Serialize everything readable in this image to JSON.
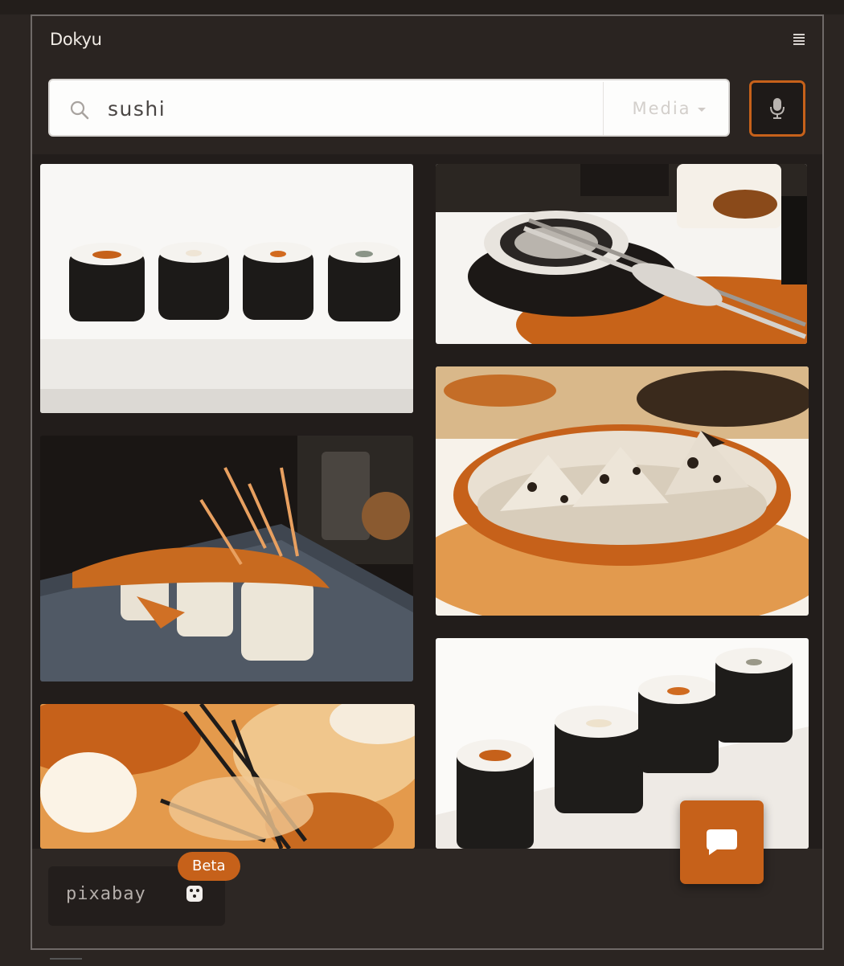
{
  "app": {
    "title": "Dokyu"
  },
  "search": {
    "query": "sushi",
    "placeholder": ""
  },
  "media_filter": {
    "label": "Media"
  },
  "icons": {
    "menu": "hamburger-menu-icon",
    "search": "search-icon",
    "mic": "microphone-icon",
    "chat": "chat-bubble-icon",
    "dice": "dice-icon",
    "caret": "chevron-down-icon"
  },
  "images": [
    {
      "name": "sushi-rolls-row-white"
    },
    {
      "name": "soy-dish-chopsticks"
    },
    {
      "name": "shrimp-tempura-roll-slate"
    },
    {
      "name": "sushi-bowl-nori"
    },
    {
      "name": "shrimp-close-up-orange"
    },
    {
      "name": "maki-rolls-plate"
    }
  ],
  "footer": {
    "provider": "pixabay",
    "badge": "Beta"
  },
  "colors": {
    "accent": "#c6611a",
    "background": "#2a2421",
    "card": "#231e1c"
  }
}
